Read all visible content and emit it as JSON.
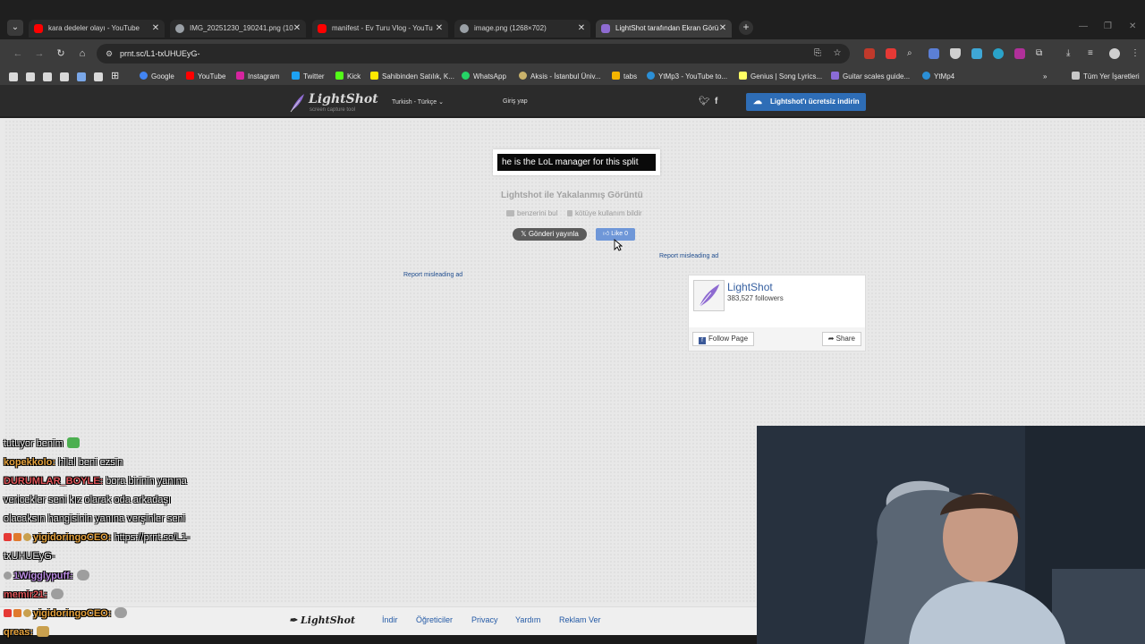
{
  "browser": {
    "tabs": [
      {
        "title": "kara dedeler olayı - YouTube",
        "icon": "youtube-icon",
        "active": false
      },
      {
        "title": "IMG_20251230_190241.png (10",
        "icon": "globe-icon",
        "active": false
      },
      {
        "title": "manifest - Ev Turu Vlog - YouTu",
        "icon": "youtube-icon",
        "active": false
      },
      {
        "title": "image.png (1268×702)",
        "icon": "globe-icon",
        "active": false
      },
      {
        "title": "LightShot tarafından Ekran Görü",
        "icon": "lightshot-icon",
        "active": true
      }
    ],
    "url": "prnt.sc/L1-txUHUEyG-",
    "bookmarks": [
      {
        "label": "Google",
        "icon": "google-icon",
        "color": "#4285f4"
      },
      {
        "label": "YouTube",
        "icon": "youtube-icon",
        "color": "#ff0000"
      },
      {
        "label": "Instagram",
        "icon": "instagram-icon",
        "color": "#d6249f"
      },
      {
        "label": "Twitter",
        "icon": "twitter-icon",
        "color": "#1da1f2"
      },
      {
        "label": "Kick",
        "icon": "kick-icon",
        "color": "#53fc18"
      },
      {
        "label": "Sahibinden Satılık, K...",
        "icon": "sahibinden-icon",
        "color": "#ffe800"
      },
      {
        "label": "WhatsApp",
        "icon": "whatsapp-icon",
        "color": "#25d366"
      },
      {
        "label": "Aksis - İstanbul Üniv...",
        "icon": "aksis-icon",
        "color": "#c9b26b"
      },
      {
        "label": "tabs",
        "icon": "tabs-icon",
        "color": "#f4b400"
      },
      {
        "label": "YtMp3 - YouTube to...",
        "icon": "ytmp3-icon",
        "color": "#2b8fd6"
      },
      {
        "label": "Genius | Song Lyrics...",
        "icon": "genius-icon",
        "color": "#ffff64"
      },
      {
        "label": "Guitar scales guide...",
        "icon": "guitar-icon",
        "color": "#8a6bd6"
      },
      {
        "label": "YtMp4",
        "icon": "ytmp4-icon",
        "color": "#2b8fd6"
      }
    ],
    "all_bookmarks": "Tüm Yer İşaretleri"
  },
  "lightshot": {
    "logo_name": "LightShot",
    "logo_tag": "screen capture tool",
    "language": "Turkish - Türkçe",
    "login": "Giriş yap",
    "download_button": "Lightshot'ı ücretsiz indirin",
    "screenshot_text": "he is the LoL manager for this split",
    "caption": "Lightshot ile Yakalanmış Görüntü",
    "find_similar": "benzerini bul",
    "report_abuse": "kötüye kullanım bildir",
    "tweet_button": "Gönderi yayınla",
    "like_button": "Like 0",
    "report_ad": "Report misleading ad",
    "fb_page_name": "LightShot",
    "fb_followers": "383,527 followers",
    "fb_follow": "Follow Page",
    "fb_share": "Share",
    "footer_logo": "LightShot",
    "footer_links": [
      "İndir",
      "Öğreticiler",
      "Privacy",
      "Yardım",
      "Reklam Ver"
    ]
  },
  "chat": [
    {
      "user": "",
      "user_color": "#e8e8e8",
      "message": "tutuyor benim",
      "emote_color": "#4caf50"
    },
    {
      "user": "kopekkolo:",
      "user_color": "#e6a23c",
      "message": "hilal beni ezsin"
    },
    {
      "user": "DURUMLAR_BOYLE:",
      "user_color": "#e0555a",
      "message": "bora birinin yanına"
    },
    {
      "user": "",
      "user_color": "#e8e8e8",
      "message": "vericekler seni kız olarak oda arkadaşı"
    },
    {
      "user": "",
      "user_color": "#e8e8e8",
      "message": "olacaksın hangisinin yanına verşinler seni"
    },
    {
      "user": "yigidoringoCEO:",
      "user_color": "#e6a23c",
      "message": "https://prnt.sc/L1-"
    },
    {
      "user": "",
      "user_color": "#e8e8e8",
      "message": "txUHUEyG-"
    },
    {
      "user": "1Wigglypuff:",
      "user_color": "#b98ae0",
      "message": "",
      "emote_color": "#9e9e9e"
    },
    {
      "user": "memir21:",
      "user_color": "#e0555a",
      "message": "",
      "emote_color": "#9e9e9e"
    },
    {
      "user": "yigidoringoCEO:",
      "user_color": "#e6a23c",
      "message": "",
      "emote_color": "#9e9e9e"
    },
    {
      "user": "qreas:",
      "user_color": "#e6a23c",
      "message": "",
      "emote_color": "#c9a04e"
    }
  ]
}
